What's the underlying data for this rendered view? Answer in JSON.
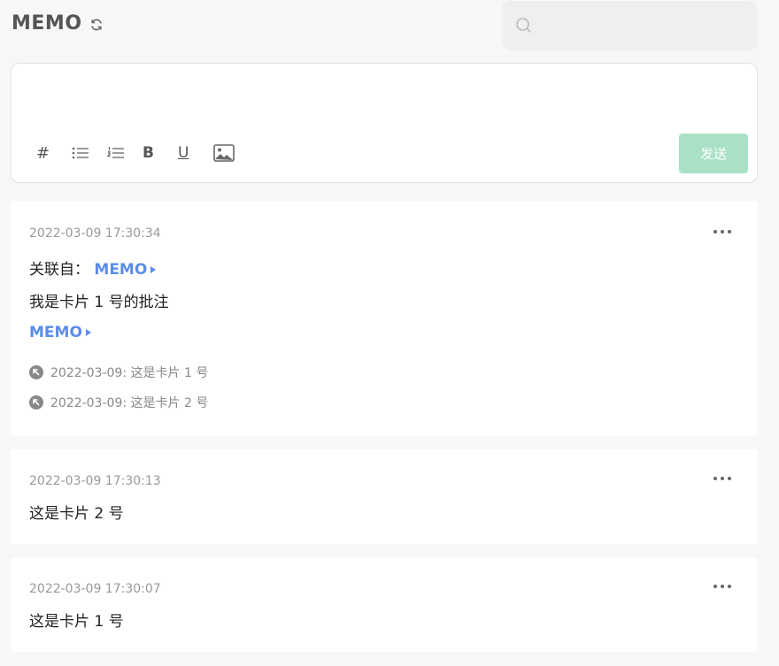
{
  "header": {
    "title": "MEMO"
  },
  "search": {
    "placeholder": ""
  },
  "editor": {
    "tools": [
      {
        "name": "tag",
        "label": "#"
      },
      {
        "name": "bullet-list"
      },
      {
        "name": "numbered-list"
      },
      {
        "name": "bold",
        "label": "B"
      },
      {
        "name": "underline",
        "label": "U"
      },
      {
        "name": "image"
      }
    ],
    "send_label": "发送"
  },
  "colors": {
    "accent": "#5b8ce8",
    "send": "#a9e1c6"
  },
  "cards": [
    {
      "time": "2022-03-09 17:30:34",
      "related_prefix": "关联自：",
      "related_link": "MEMO",
      "content": "我是卡片 1 号的批注",
      "link": "MEMO",
      "refs": [
        "2022-03-09: 这是卡片 1 号",
        "2022-03-09: 这是卡片 2 号"
      ]
    },
    {
      "time": "2022-03-09 17:30:13",
      "content": "这是卡片 2 号"
    },
    {
      "time": "2022-03-09 17:30:07",
      "content": "这是卡片 1 号"
    }
  ]
}
